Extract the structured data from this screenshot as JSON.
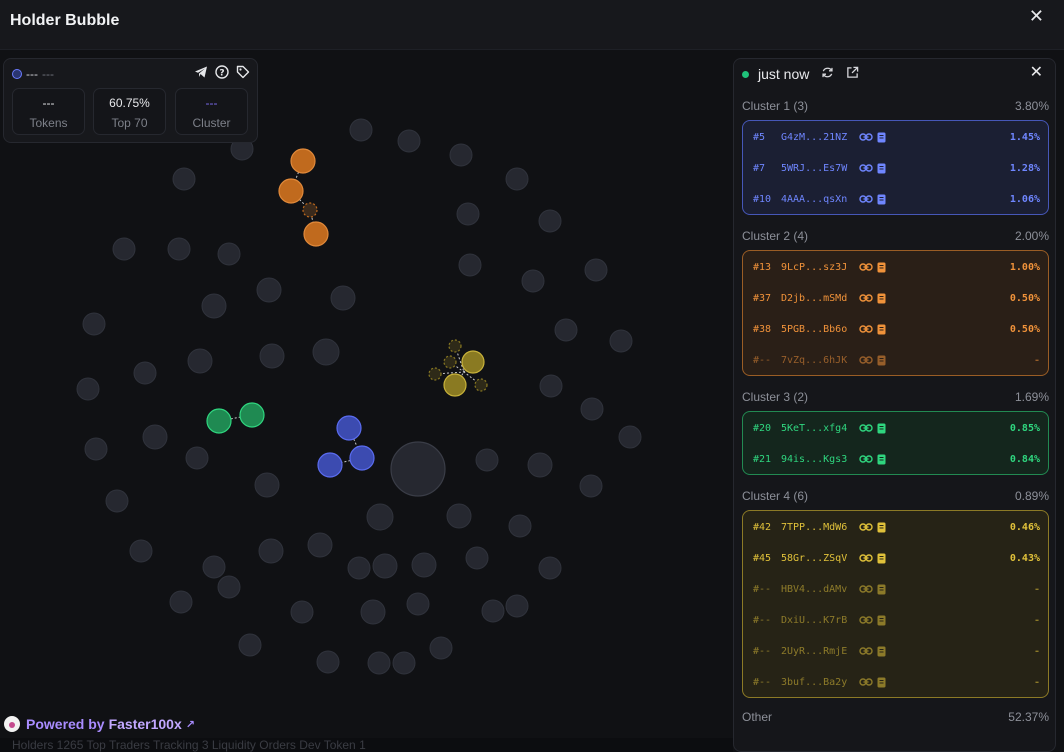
{
  "app": {
    "title": "Holder Bubble",
    "close_icon": "close-icon"
  },
  "stats": {
    "name": "---",
    "symbol": "---",
    "icons": [
      "telegram-icon",
      "help-icon",
      "tag-icon"
    ],
    "tokens_value": "---",
    "tokens_label": "Tokens",
    "top_value": "60.75%",
    "top_label": "Top 70",
    "cluster_value": "---",
    "cluster_label": "Cluster"
  },
  "panel": {
    "status": "just now",
    "icons": [
      "refresh-icon",
      "external-link-icon",
      "close-icon"
    ],
    "clusters": [
      {
        "label": "Cluster 1 (3)",
        "total": "3.80%",
        "color": "#6f86ff",
        "bg": "#1b1f33",
        "border": "#4657b8",
        "rows": [
          {
            "rank": "#5",
            "addr": "G4zM...21NZ",
            "pct": "1.45%",
            "faded": false
          },
          {
            "rank": "#7",
            "addr": "5WRJ...Es7W",
            "pct": "1.28%",
            "faded": false
          },
          {
            "rank": "#10",
            "addr": "4AAA...qsXn",
            "pct": "1.06%",
            "faded": false
          }
        ]
      },
      {
        "label": "Cluster 2 (4)",
        "total": "2.00%",
        "color": "#f0923a",
        "bg": "#2a1f17",
        "border": "#9a5d25",
        "rows": [
          {
            "rank": "#13",
            "addr": "9LcP...sz3J",
            "pct": "1.00%",
            "faded": false
          },
          {
            "rank": "#37",
            "addr": "D2jb...mSMd",
            "pct": "0.50%",
            "faded": false
          },
          {
            "rank": "#38",
            "addr": "5PGB...Bb6o",
            "pct": "0.50%",
            "faded": false
          },
          {
            "rank": "#--",
            "addr": "7vZq...6hJK",
            "pct": "-",
            "faded": true
          }
        ]
      },
      {
        "label": "Cluster 3 (2)",
        "total": "1.69%",
        "color": "#2fd67f",
        "bg": "#14261d",
        "border": "#228a52",
        "rows": [
          {
            "rank": "#20",
            "addr": "5KeT...xfg4",
            "pct": "0.85%",
            "faded": false
          },
          {
            "rank": "#21",
            "addr": "94is...Kgs3",
            "pct": "0.84%",
            "faded": false
          }
        ]
      },
      {
        "label": "Cluster 4 (6)",
        "total": "0.89%",
        "color": "#e0c13a",
        "bg": "#262316",
        "border": "#8c7a26",
        "rows": [
          {
            "rank": "#42",
            "addr": "7TPP...MdW6",
            "pct": "0.46%",
            "faded": false
          },
          {
            "rank": "#45",
            "addr": "58Gr...ZSqV",
            "pct": "0.43%",
            "faded": false
          },
          {
            "rank": "#--",
            "addr": "HBV4...dAMv",
            "pct": "-",
            "faded": true
          },
          {
            "rank": "#--",
            "addr": "DxiU...K7rB",
            "pct": "-",
            "faded": true
          },
          {
            "rank": "#--",
            "addr": "2UyR...RmjE",
            "pct": "-",
            "faded": true
          },
          {
            "rank": "#--",
            "addr": "3buf...Ba2y",
            "pct": "-",
            "faded": true
          }
        ]
      }
    ],
    "other_label": "Other",
    "other_total": "52.37%"
  },
  "footer": {
    "prefix": "Powered by",
    "brand": "Faster100x"
  },
  "bottom_strip": "Holders 1265   Top Traders   Tracking 3   Liquidity   Orders   Dev Token 1"
}
